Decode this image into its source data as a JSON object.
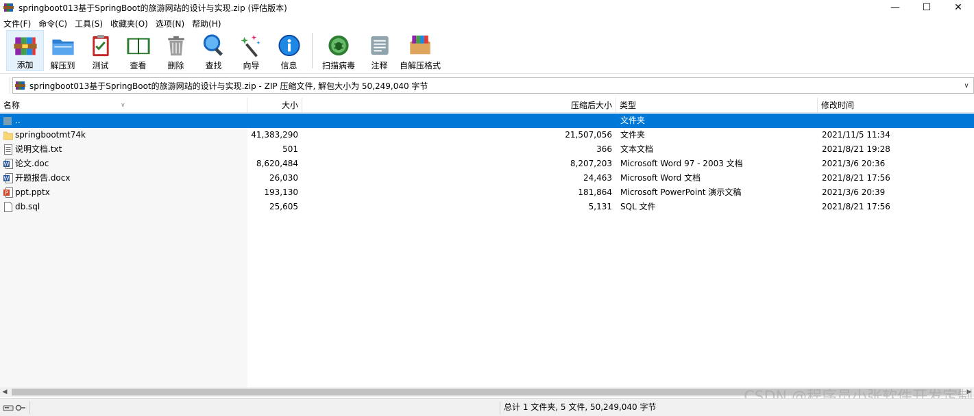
{
  "window": {
    "title": "springboot013基于SpringBoot的旅游网站的设计与实现.zip (评估版本)",
    "minimize": "—",
    "maximize": "☐",
    "close": "✕"
  },
  "menu": [
    {
      "label": "文件(F)"
    },
    {
      "label": "命令(C)"
    },
    {
      "label": "工具(S)"
    },
    {
      "label": "收藏夹(O)"
    },
    {
      "label": "选项(N)"
    },
    {
      "label": "帮助(H)"
    }
  ],
  "toolbar": [
    {
      "label": "添加",
      "icon": "add-archive-icon"
    },
    {
      "label": "解压到",
      "icon": "extract-folder-icon"
    },
    {
      "label": "测试",
      "icon": "test-clipboard-icon"
    },
    {
      "label": "查看",
      "icon": "view-book-icon"
    },
    {
      "label": "删除",
      "icon": "trash-icon"
    },
    {
      "label": "查找",
      "icon": "find-magnifier-icon"
    },
    {
      "label": "向导",
      "icon": "wizard-wand-icon"
    },
    {
      "label": "信息",
      "icon": "info-icon"
    },
    {
      "label": "扫描病毒",
      "icon": "virus-scan-icon"
    },
    {
      "label": "注释",
      "icon": "comment-icon"
    },
    {
      "label": "自解压格式",
      "icon": "sfx-archive-icon"
    }
  ],
  "address": {
    "text": "springboot013基于SpringBoot的旅游网站的设计与实现.zip - ZIP 压缩文件, 解包大小为 50,249,040 字节"
  },
  "columns": {
    "name": "名称",
    "size": "大小",
    "packed": "压缩后大小",
    "type": "类型",
    "modified": "修改时间"
  },
  "files": [
    {
      "name": "..",
      "size": "",
      "packed": "",
      "type": "文件夹",
      "modified": "",
      "icon": "parent-folder-icon"
    },
    {
      "name": "springbootmt74k",
      "size": "41,383,290",
      "packed": "21,507,056",
      "type": "文件夹",
      "modified": "2021/11/5 11:34",
      "icon": "folder-icon"
    },
    {
      "name": "说明文档.txt",
      "size": "501",
      "packed": "366",
      "type": "文本文档",
      "modified": "2021/8/21 19:28",
      "icon": "text-file-icon"
    },
    {
      "name": "论文.doc",
      "size": "8,620,484",
      "packed": "8,207,203",
      "type": "Microsoft Word 97 - 2003 文档",
      "modified": "2021/3/6 20:36",
      "icon": "word-doc-icon"
    },
    {
      "name": "开题报告.docx",
      "size": "26,030",
      "packed": "24,463",
      "type": "Microsoft Word 文档",
      "modified": "2021/8/21 17:56",
      "icon": "word-docx-icon"
    },
    {
      "name": "ppt.pptx",
      "size": "193,130",
      "packed": "181,864",
      "type": "Microsoft PowerPoint 演示文稿",
      "modified": "2021/3/6 20:39",
      "icon": "powerpoint-icon"
    },
    {
      "name": "db.sql",
      "size": "25,605",
      "packed": "5,131",
      "type": "SQL 文件",
      "modified": "2021/8/21 17:56",
      "icon": "sql-file-icon"
    }
  ],
  "status": {
    "summary": "总计 1 文件夹, 5 文件, 50,249,040 字节"
  },
  "watermark": "CSDN @程序员小张软件开发定制",
  "colors": {
    "selection": "#0078d7",
    "folder": "#f7d675"
  }
}
